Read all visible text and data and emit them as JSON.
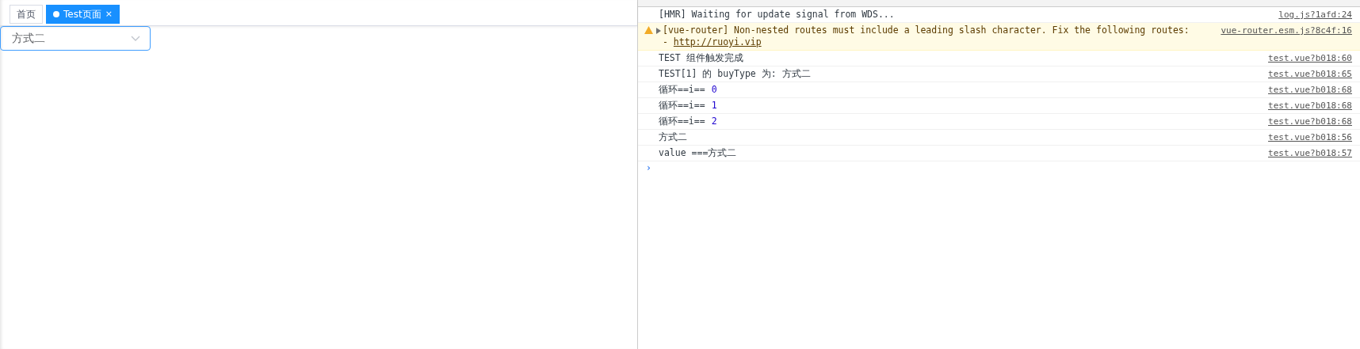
{
  "tabs": [
    {
      "label": "首页",
      "selected": false
    },
    {
      "label": "Test页面",
      "selected": true,
      "close": "×"
    }
  ],
  "select": {
    "value": "方式二",
    "focused": true
  },
  "console": {
    "messages": [
      {
        "kind": "log",
        "text": "[HMR] Waiting for update signal from WDS...",
        "source": "log.js?1afd:24"
      },
      {
        "kind": "warning",
        "text": "[vue-router] Non-nested routes must include a leading slash character. Fix the following routes:",
        "second_line": "- ",
        "link": "http://ruoyi.vip",
        "source": "vue-router.esm.js?8c4f:16"
      },
      {
        "kind": "log",
        "text": "TEST 组件触发完成",
        "source": "test.vue?b018:60"
      },
      {
        "kind": "log",
        "text": "TEST[1] 的 buyType 为: 方式二",
        "source": "test.vue?b018:65"
      },
      {
        "kind": "log",
        "text": "循环==i==",
        "number": "0",
        "source": "test.vue?b018:68"
      },
      {
        "kind": "log",
        "text": "循环==i==",
        "number": "1",
        "source": "test.vue?b018:68"
      },
      {
        "kind": "log",
        "text": "循环==i==",
        "number": "2",
        "source": "test.vue?b018:68"
      },
      {
        "kind": "log",
        "text": "方式二",
        "source": "test.vue?b018:56"
      },
      {
        "kind": "log",
        "text": "value ===方式二",
        "source": "test.vue?b018:57"
      }
    ],
    "prompt": "›"
  }
}
